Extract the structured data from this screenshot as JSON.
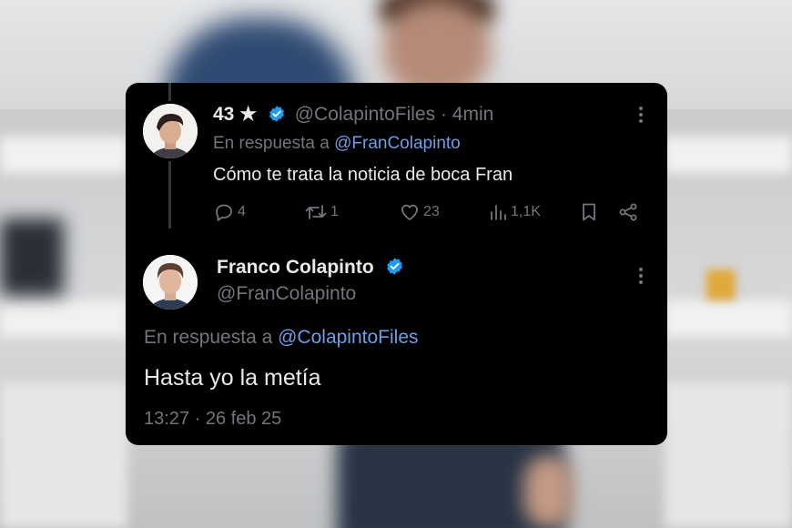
{
  "reply_tweet": {
    "display_name": "43",
    "star_glyph": "★",
    "handle": "@ColapintoFiles",
    "separator": "·",
    "time_ago": "4min",
    "reply_prefix": "En respuesta a",
    "reply_to": "@FranColapinto",
    "text": "Cómo te trata la noticia de boca Fran",
    "stats": {
      "replies": "4",
      "reposts": "1",
      "likes": "23",
      "views": "1,1K"
    }
  },
  "main_tweet": {
    "display_name": "Franco Colapinto",
    "handle": "@FranColapinto",
    "reply_prefix": "En respuesta a",
    "reply_to": "@ColapintoFiles",
    "text": "Hasta yo la metía",
    "time": "13:27",
    "separator": "·",
    "date": "26 feb 25"
  },
  "icons": {
    "verified": "verified-badge-icon",
    "reply": "reply-icon",
    "repost": "repost-icon",
    "like": "heart-icon",
    "views": "views-icon",
    "bookmark": "bookmark-icon",
    "share": "share-icon",
    "more": "more-vertical-icon"
  },
  "colors": {
    "card_bg": "#000000",
    "text": "#e7e9ea",
    "muted": "#71767b",
    "link": "#6d9ee6",
    "verified": "#1d9bf0"
  }
}
